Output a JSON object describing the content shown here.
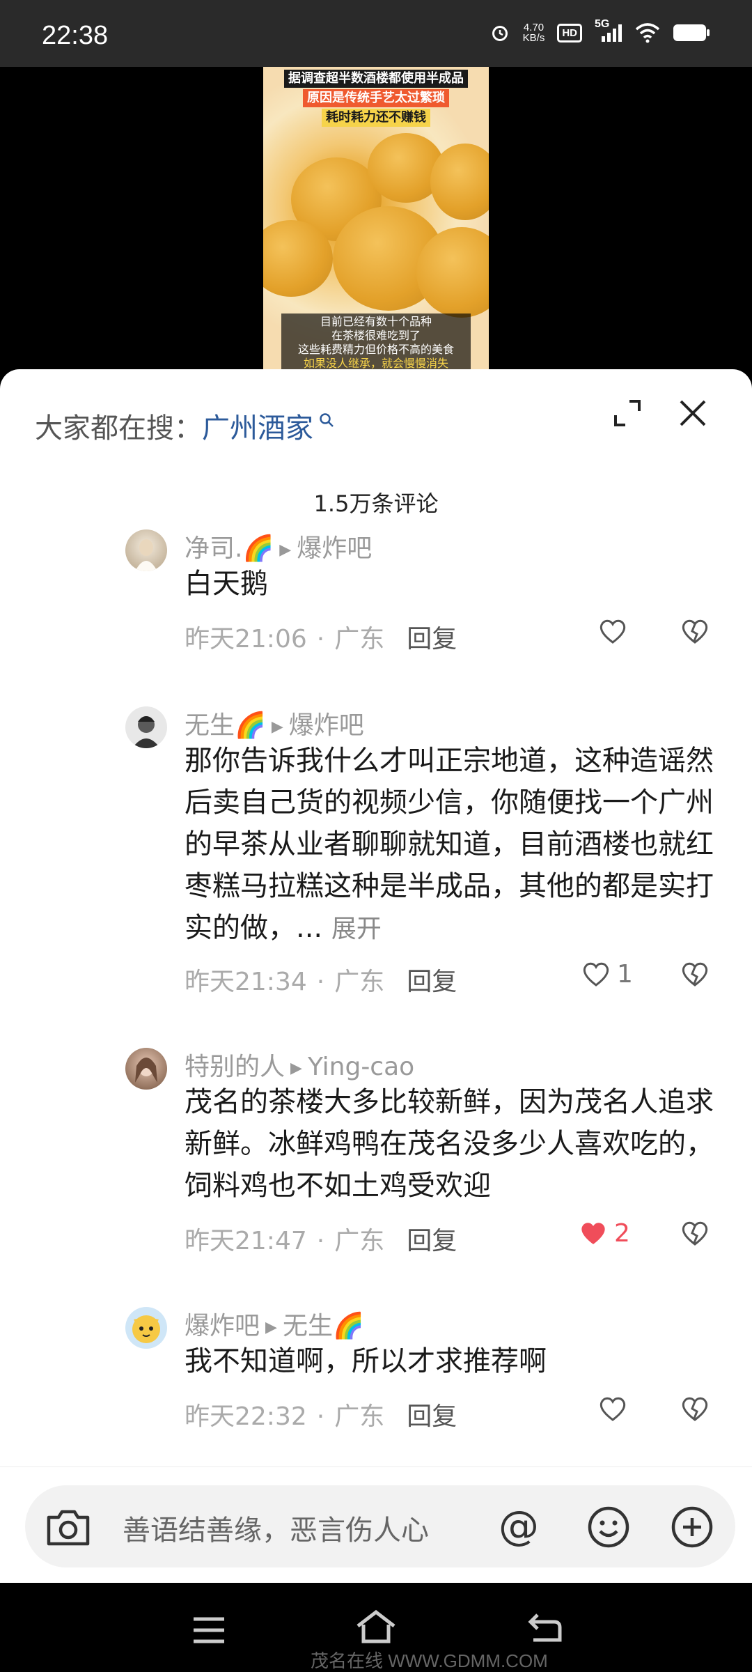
{
  "status_bar": {
    "time": "22:38",
    "net_speed_value": "4.70",
    "net_speed_unit": "KB/s",
    "hd_badge": "HD",
    "network": "5G",
    "icons": [
      "alarm-icon",
      "signal-icon",
      "wifi-icon",
      "battery-icon"
    ]
  },
  "video": {
    "caption_top": [
      "据调查超半数酒楼都使用半成品",
      "原因是传统手艺太过繁琐",
      "耗时耗力还不赚钱"
    ],
    "caption_bottom": [
      "目前已经有数十个品种",
      "在茶楼很难吃到了",
      "这些耗费精力但价格不高的美食",
      "如果没人继承，就会慢慢消失"
    ]
  },
  "sheet": {
    "search_prefix": "大家都在搜：",
    "search_keyword": "广州酒家",
    "comment_count": "1.5万条评论"
  },
  "comments": [
    {
      "user": "净司.🌈",
      "reply_to": "爆炸吧",
      "text": "白天鹅",
      "time": "昨天21:06",
      "location": "广东",
      "reply_label": "回复",
      "likes": ""
    },
    {
      "user": "无生🌈",
      "reply_to": "爆炸吧",
      "text": "那你告诉我什么才叫正宗地道，这种造谣然后卖自己货的视频少信，你随便找一个广州的早茶从业者聊聊就知道，目前酒楼也就红枣糕马拉糕这种是半成品，其他的都是实打实的做，...",
      "more": "展开",
      "time": "昨天21:34",
      "location": "广东",
      "reply_label": "回复",
      "likes": "1"
    },
    {
      "user": "特别的人",
      "reply_to": "Ying-cao",
      "text": "茂名的茶楼大多比较新鲜，因为茂名人追求新鲜。冰鲜鸡鸭在茂名没多少人喜欢吃的，饲料鸡也不如土鸡受欢迎",
      "time": "昨天21:47",
      "location": "广东",
      "reply_label": "回复",
      "likes": "2"
    },
    {
      "user": "爆炸吧",
      "reply_to": "无生🌈",
      "text": "我不知道啊，所以才求推荐啊",
      "time": "昨天22:32",
      "location": "广东",
      "reply_label": "回复",
      "likes": ""
    }
  ],
  "input": {
    "placeholder": "善语结善缘，恶言伤人心",
    "at_symbol": "@"
  },
  "nav": {
    "watermark": "茂名在线 WWW.GDMM.COM"
  },
  "colors": {
    "keyword": "#2c5a9a",
    "liked": "#f04d5a"
  }
}
